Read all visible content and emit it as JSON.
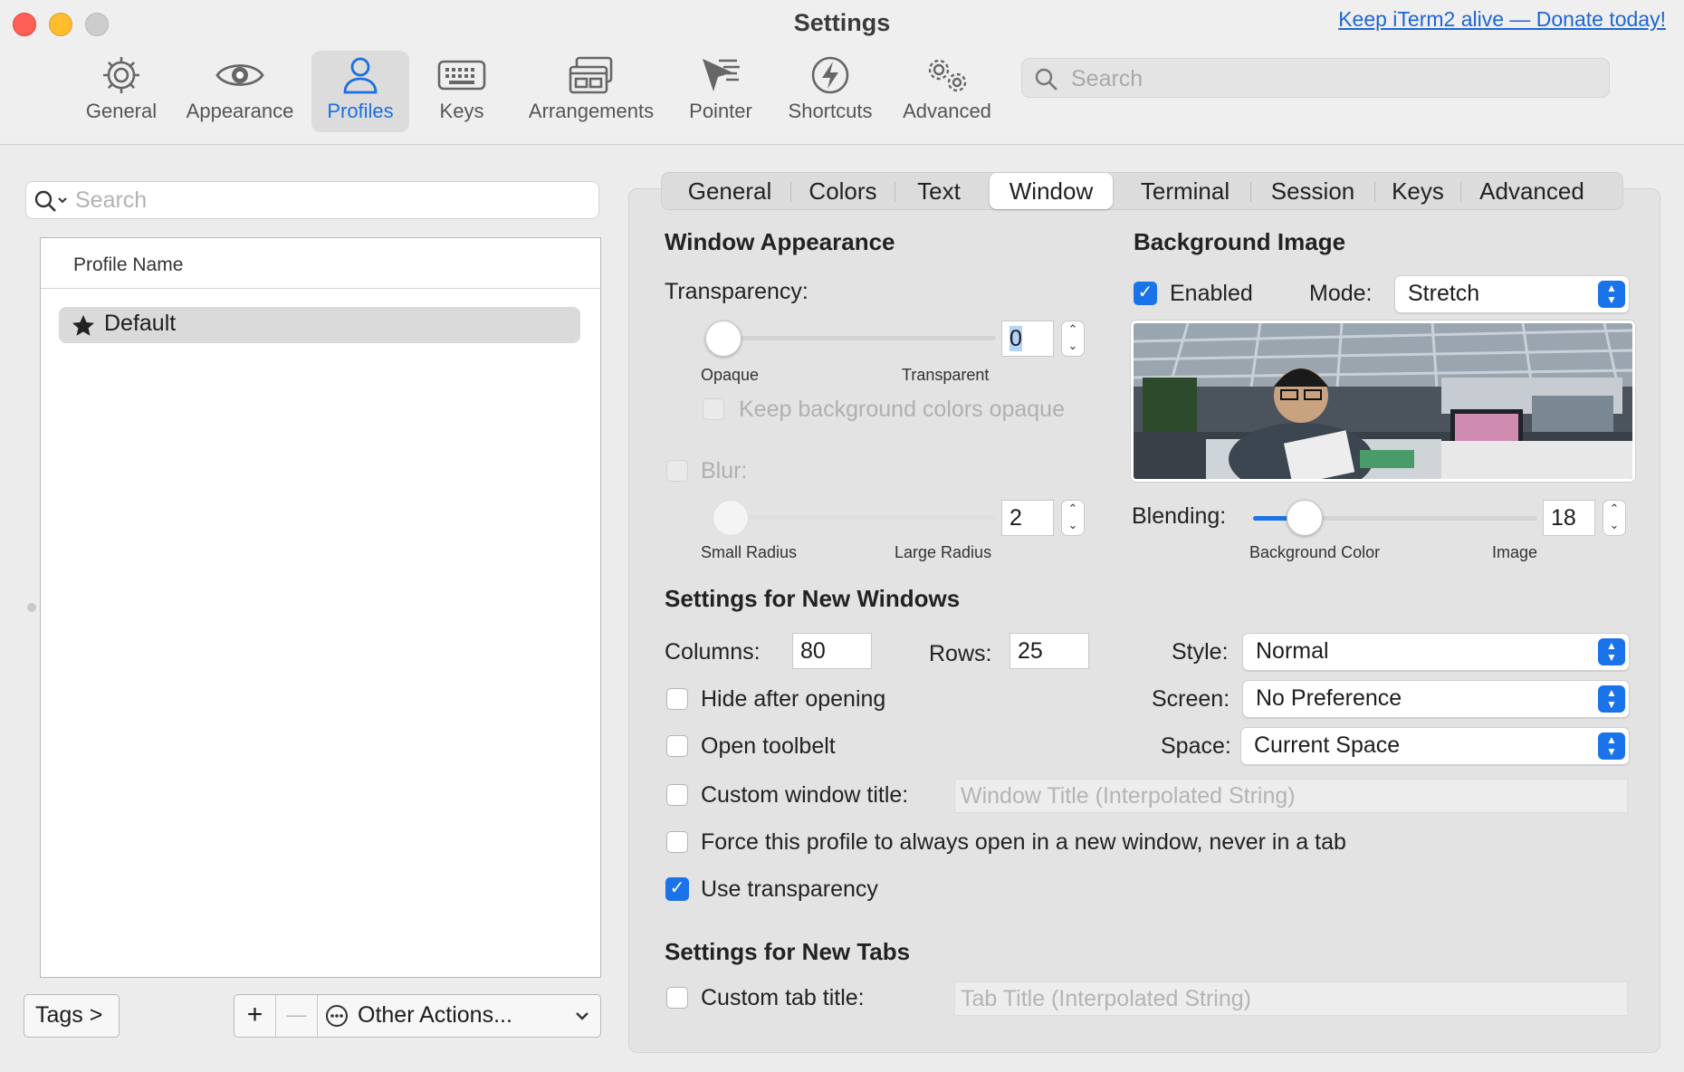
{
  "window": {
    "title": "Settings",
    "donate_link": "Keep iTerm2 alive — Donate today!"
  },
  "toolbar": {
    "items": [
      {
        "label": "General",
        "icon": "gear-icon"
      },
      {
        "label": "Appearance",
        "icon": "eye-icon"
      },
      {
        "label": "Profiles",
        "icon": "person-icon",
        "selected": true
      },
      {
        "label": "Keys",
        "icon": "keyboard-icon"
      },
      {
        "label": "Arrangements",
        "icon": "windows-icon"
      },
      {
        "label": "Pointer",
        "icon": "pointer-icon"
      },
      {
        "label": "Shortcuts",
        "icon": "bolt-icon"
      },
      {
        "label": "Advanced",
        "icon": "gears-icon"
      }
    ],
    "search_placeholder": "Search"
  },
  "sidebar": {
    "search_placeholder": "Search",
    "column_header": "Profile Name",
    "profiles": [
      {
        "name": "Default",
        "icon": "star-icon"
      }
    ],
    "tags_button": "Tags >",
    "add_button": "+",
    "remove_button": "—",
    "other_actions": "Other Actions..."
  },
  "tabs": [
    "General",
    "Colors",
    "Text",
    "Window",
    "Terminal",
    "Session",
    "Keys",
    "Advanced"
  ],
  "selected_tab": "Window",
  "window_appearance": {
    "heading": "Window Appearance",
    "transparency_label": "Transparency:",
    "transparency_value": "0",
    "transparency_min_label": "Opaque",
    "transparency_max_label": "Transparent",
    "keep_bg_opaque_label": "Keep background colors opaque",
    "blur_label": "Blur:",
    "blur_value": "2",
    "blur_min_label": "Small Radius",
    "blur_max_label": "Large Radius"
  },
  "background_image": {
    "heading": "Background Image",
    "enabled_label": "Enabled",
    "enabled": true,
    "mode_label": "Mode:",
    "mode_value": "Stretch",
    "blending_label": "Blending:",
    "blending_value": "18",
    "blending_fraction": 0.18,
    "blending_min_label": "Background Color",
    "blending_max_label": "Image"
  },
  "new_windows": {
    "heading": "Settings for New Windows",
    "columns_label": "Columns:",
    "columns_value": "80",
    "rows_label": "Rows:",
    "rows_value": "25",
    "style_label": "Style:",
    "style_value": "Normal",
    "screen_label": "Screen:",
    "screen_value": "No Preference",
    "space_label": "Space:",
    "space_value": "Current Space",
    "hide_after_opening": "Hide after opening",
    "open_toolbelt": "Open toolbelt",
    "custom_window_title": "Custom window title:",
    "window_title_placeholder": "Window Title (Interpolated String)",
    "force_new_window": "Force this profile to always open in a new window, never in a tab",
    "use_transparency": "Use transparency",
    "use_transparency_checked": true
  },
  "new_tabs": {
    "heading": "Settings for New Tabs",
    "custom_tab_title": "Custom tab title:",
    "tab_title_placeholder": "Tab Title (Interpolated String)"
  },
  "colors": {
    "accent": "#1a73e8",
    "close": "#fe5f57",
    "minimize": "#febc2e",
    "zoom": "#c8c8c8"
  }
}
